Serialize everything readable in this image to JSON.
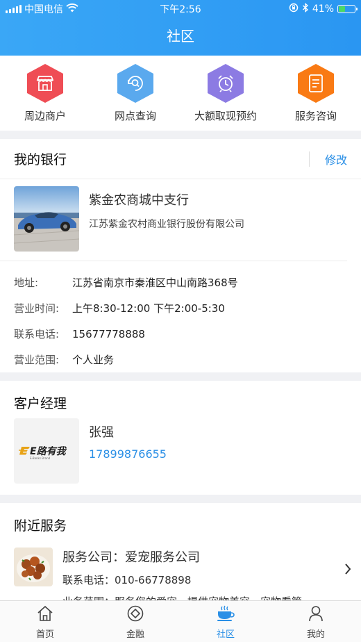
{
  "status_bar": {
    "carrier": "中国电信",
    "time": "下午2:56",
    "battery": "41%",
    "battery_level": 0.41
  },
  "header": {
    "title": "社区"
  },
  "quick_actions": [
    {
      "label": "周边商户",
      "icon": "store-icon",
      "color": "#ef4d55"
    },
    {
      "label": "网点查询",
      "icon": "search-location-icon",
      "color": "#5aa9ee"
    },
    {
      "label": "大额取现预约",
      "icon": "alarm-clock-icon",
      "color": "#8c7be3"
    },
    {
      "label": "服务咨询",
      "icon": "document-icon",
      "color": "#f97a14"
    }
  ],
  "my_bank": {
    "title": "我的银行",
    "edit_label": "修改",
    "branch_name": "紫金农商城中支行",
    "corporation": "江苏紫金农村商业银行股份有限公司",
    "details": [
      {
        "key": "地址:",
        "value": "江苏省南京市秦淮区中山南路368号"
      },
      {
        "key": "营业时间:",
        "value": "上午8:30-12:00  下午2:00-5:30"
      },
      {
        "key": "联系电话:",
        "value": "15677778888"
      },
      {
        "key": "营业范围:",
        "value": "个人业务"
      }
    ]
  },
  "manager": {
    "title": "客户经理",
    "logo_text": "E路有我",
    "logo_subtext": "E-Banks Brand",
    "name": "张强",
    "phone": "17899876655"
  },
  "nearby": {
    "title": "附近服务",
    "company": "服务公司：爱宠服务公司",
    "tel": "联系电话：010-66778898",
    "scope": "业务范围：服务您的爱宠，提供宠物美容，宠物看管"
  },
  "tabbar": [
    {
      "label": "首页",
      "icon": "home-icon",
      "active": false
    },
    {
      "label": "金融",
      "icon": "finance-icon",
      "active": false
    },
    {
      "label": "社区",
      "icon": "community-cup-icon",
      "active": true
    },
    {
      "label": "我的",
      "icon": "profile-icon",
      "active": false
    }
  ]
}
